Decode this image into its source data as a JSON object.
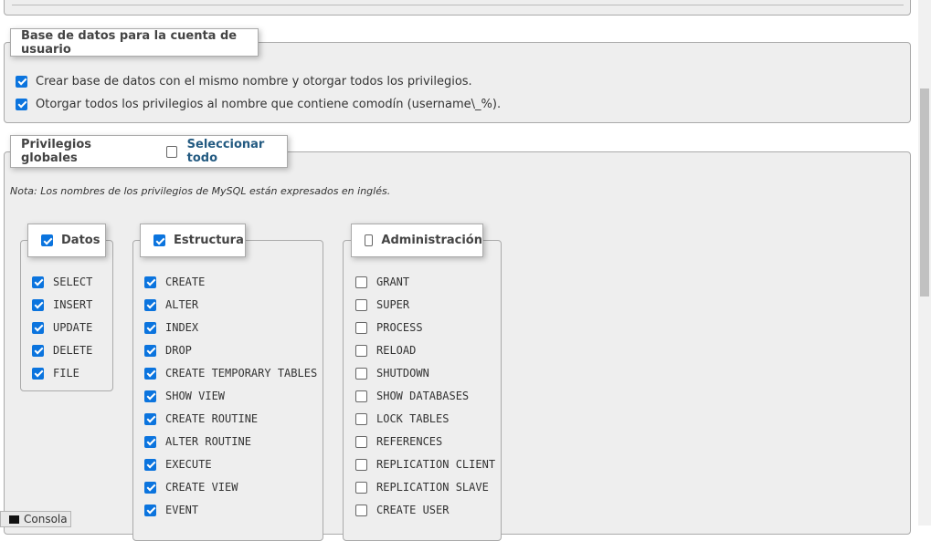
{
  "db_section": {
    "legend": "Base de datos para la cuenta de usuario",
    "options": [
      {
        "label": "Crear base de datos con el mismo nombre y otorgar todos los privilegios.",
        "checked": true
      },
      {
        "label": "Otorgar todos los privilegios al nombre que contiene comodín (username\\_%).",
        "checked": true
      }
    ]
  },
  "global_privileges": {
    "legend": "Privilegios globales",
    "select_all_label": "Seleccionar todo",
    "select_all_checked": false,
    "note": "Nota: Los nombres de los privilegios de MySQL están expresados en inglés.",
    "groups": [
      {
        "title": "Datos",
        "checked": true,
        "items": [
          {
            "label": "SELECT",
            "checked": true
          },
          {
            "label": "INSERT",
            "checked": true
          },
          {
            "label": "UPDATE",
            "checked": true
          },
          {
            "label": "DELETE",
            "checked": true
          },
          {
            "label": "FILE",
            "checked": true
          }
        ]
      },
      {
        "title": "Estructura",
        "checked": true,
        "items": [
          {
            "label": "CREATE",
            "checked": true
          },
          {
            "label": "ALTER",
            "checked": true
          },
          {
            "label": "INDEX",
            "checked": true
          },
          {
            "label": "DROP",
            "checked": true
          },
          {
            "label": "CREATE TEMPORARY TABLES",
            "checked": true
          },
          {
            "label": "SHOW VIEW",
            "checked": true
          },
          {
            "label": "CREATE ROUTINE",
            "checked": true
          },
          {
            "label": "ALTER ROUTINE",
            "checked": true
          },
          {
            "label": "EXECUTE",
            "checked": true
          },
          {
            "label": "CREATE VIEW",
            "checked": true
          },
          {
            "label": "EVENT",
            "checked": true
          }
        ]
      },
      {
        "title": "Administración",
        "checked": false,
        "items": [
          {
            "label": "GRANT",
            "checked": false
          },
          {
            "label": "SUPER",
            "checked": false
          },
          {
            "label": "PROCESS",
            "checked": false
          },
          {
            "label": "RELOAD",
            "checked": false
          },
          {
            "label": "SHUTDOWN",
            "checked": false
          },
          {
            "label": "SHOW DATABASES",
            "checked": false
          },
          {
            "label": "LOCK TABLES",
            "checked": false
          },
          {
            "label": "REFERENCES",
            "checked": false
          },
          {
            "label": "REPLICATION CLIENT",
            "checked": false
          },
          {
            "label": "REPLICATION SLAVE",
            "checked": false
          },
          {
            "label": "CREATE USER",
            "checked": false
          }
        ]
      }
    ]
  },
  "console": {
    "label": "Consola"
  },
  "colors": {
    "accent": "#0b74de",
    "link": "#235a81",
    "panel_bg": "#eeeeee"
  }
}
